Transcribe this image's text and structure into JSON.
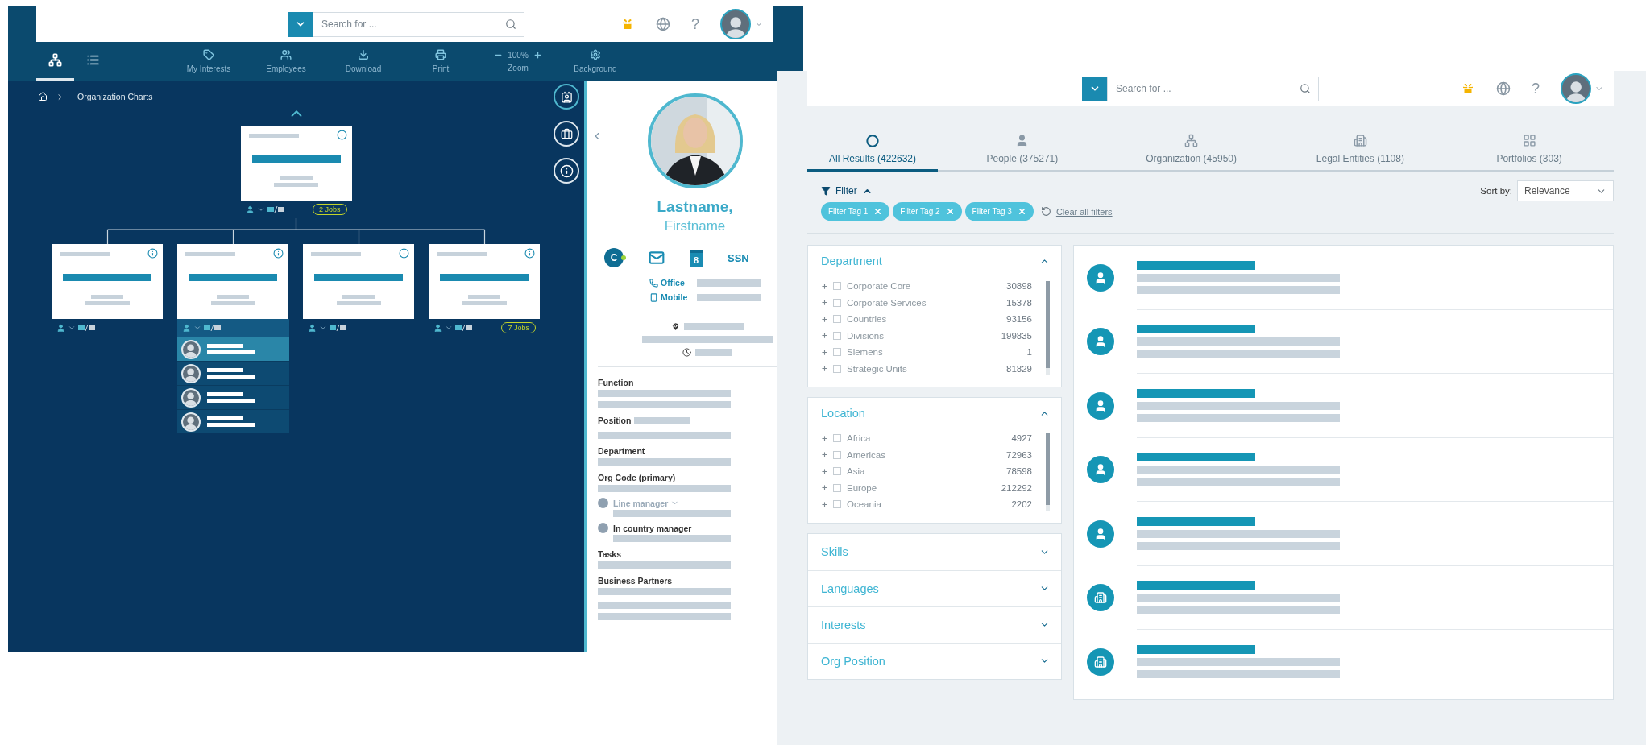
{
  "org_window": {
    "search": {
      "placeholder": "Search for ..."
    },
    "help": "?",
    "views": [
      {
        "kind": "chart",
        "selected": true
      },
      {
        "kind": "list",
        "selected": false
      }
    ],
    "actions": [
      {
        "kind": "interests",
        "label": "My Interests"
      },
      {
        "kind": "employees",
        "label": "Employees"
      },
      {
        "kind": "download",
        "label": "Download"
      },
      {
        "kind": "print",
        "label": "Print"
      },
      {
        "kind": "zoom",
        "label": "Zoom",
        "value": "100%"
      },
      {
        "kind": "background",
        "label": "Background"
      }
    ],
    "breadcrumb": [
      "Organization Charts"
    ],
    "root": {
      "jobs": "2 Jobs"
    },
    "units": [
      {
        "expanded": false
      },
      {
        "expanded": true,
        "members": [
          {
            "selected": true
          },
          {
            "selected": false
          },
          {
            "selected": false
          },
          {
            "selected": false
          }
        ]
      },
      {
        "expanded": false
      },
      {
        "expanded": false,
        "jobs": "7 Jobs"
      }
    ],
    "profile": {
      "last_name": "Lastname,",
      "first_name": "Firstname",
      "actions": [
        {
          "kind": "initial",
          "label": "C",
          "online": true
        },
        {
          "kind": "mail"
        },
        {
          "kind": "calendar",
          "label": "8"
        },
        {
          "kind": "text",
          "label": "SSN"
        }
      ],
      "phones": [
        {
          "kind": "office",
          "label": "Office"
        },
        {
          "kind": "mobile",
          "label": "Mobile"
        }
      ],
      "fields": [
        {
          "kind": "double",
          "label": "Function"
        },
        {
          "kind": "inline",
          "label": "Position"
        },
        {
          "kind": "single",
          "label": "Department"
        },
        {
          "kind": "single",
          "label": "Org Code (primary)"
        },
        {
          "kind": "manager",
          "label": "Line manager",
          "collapsible": true
        },
        {
          "kind": "manager",
          "label": "In country manager",
          "collapsible": false
        },
        {
          "kind": "single",
          "label": "Tasks"
        },
        {
          "kind": "triple",
          "label": "Business Partners"
        }
      ]
    }
  },
  "search_window": {
    "search": {
      "placeholder": "Search for ..."
    },
    "help": "?",
    "tabs": [
      {
        "kind": "all",
        "label": "All Results (422632)",
        "selected": true
      },
      {
        "kind": "people",
        "label": "People (375271)",
        "selected": false
      },
      {
        "kind": "organization",
        "label": "Organization (45950)",
        "selected": false
      },
      {
        "kind": "legal",
        "label": "Legal Entities (1108)",
        "selected": false
      },
      {
        "kind": "portfolios",
        "label": "Portfolios (303)",
        "selected": false
      }
    ],
    "filter": {
      "label": "Filter",
      "expanded": true
    },
    "sort": {
      "label": "Sort by:",
      "value": "Relevance"
    },
    "tags": [
      "Filter Tag 1",
      "Filter Tag 2",
      "Filter Tag 3"
    ],
    "clear": "Clear all filters",
    "facets": [
      {
        "title": "Department",
        "expanded": true,
        "options": [
          {
            "label": "Corporate Core",
            "count": "30898",
            "checked": false
          },
          {
            "label": "Corporate Services",
            "count": "15378",
            "checked": false
          },
          {
            "label": "Countries",
            "count": "93156",
            "checked": false
          },
          {
            "label": "Divisions",
            "count": "199835",
            "checked": false
          },
          {
            "label": "Siemens",
            "count": "1",
            "checked": false
          },
          {
            "label": "Strategic Units",
            "count": "81829",
            "checked": false
          }
        ]
      },
      {
        "title": "Location",
        "expanded": true,
        "options": [
          {
            "label": "Africa",
            "count": "4927",
            "checked": false
          },
          {
            "label": "Americas",
            "count": "72963",
            "checked": false
          },
          {
            "label": "Asia",
            "count": "78598",
            "checked": false
          },
          {
            "label": "Europe",
            "count": "212292",
            "checked": false
          },
          {
            "label": "Oceania",
            "count": "2202",
            "checked": false
          }
        ]
      },
      {
        "title": "Skills",
        "expanded": false
      },
      {
        "title": "Languages",
        "expanded": false
      },
      {
        "title": "Interests",
        "expanded": false
      },
      {
        "title": "Org Position",
        "expanded": false
      }
    ],
    "results": [
      {
        "kind": "person"
      },
      {
        "kind": "person"
      },
      {
        "kind": "person"
      },
      {
        "kind": "person"
      },
      {
        "kind": "person"
      },
      {
        "kind": "entity"
      },
      {
        "kind": "entity"
      }
    ]
  }
}
